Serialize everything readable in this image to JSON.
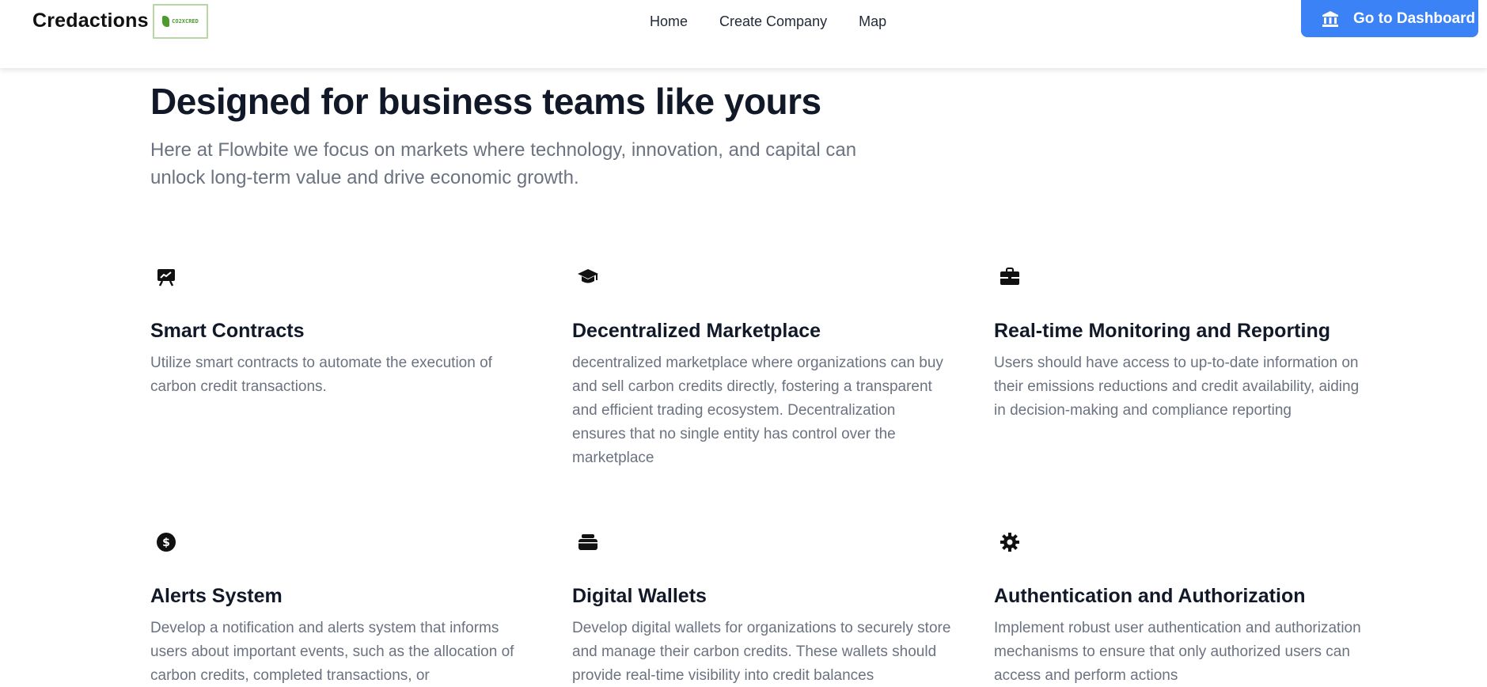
{
  "header": {
    "brand": "Credactions",
    "logo_text": "CO2XCRED",
    "nav": [
      {
        "label": "Home"
      },
      {
        "label": "Create Company"
      },
      {
        "label": "Map"
      }
    ],
    "dashboard_button": "Go to Dashboard"
  },
  "hero": {
    "title": "Designed for business teams like yours",
    "subtitle": "Here at Flowbite we focus on markets where technology, innovation, and capital can unlock long-term value and drive economic growth."
  },
  "features": [
    {
      "icon": "presentation-chart-icon",
      "title": "Smart Contracts",
      "description": "Utilize smart contracts to automate the execution of carbon credit transactions."
    },
    {
      "icon": "graduation-cap-icon",
      "title": "Decentralized Marketplace",
      "description": "decentralized marketplace where organizations can buy and sell carbon credits directly, fostering a transparent and efficient trading ecosystem. Decentralization ensures that no single entity has control over the marketplace"
    },
    {
      "icon": "briefcase-icon",
      "title": "Real-time Monitoring and Reporting",
      "description": "Users should have access to up-to-date information on their emissions reductions and credit availability, aiding in decision-making and compliance reporting"
    },
    {
      "icon": "dollar-circle-icon",
      "title": "Alerts System",
      "description": "Develop a notification and alerts system that informs users about important events, such as the allocation of carbon credits, completed transactions, or"
    },
    {
      "icon": "wallet-icon",
      "title": "Digital Wallets",
      "description": "Develop digital wallets for organizations to securely store and manage their carbon credits. These wallets should provide real-time visibility into credit balances"
    },
    {
      "icon": "gear-icon",
      "title": "Authentication and Authorization",
      "description": "Implement robust user authentication and authorization mechanisms to ensure that only authorized users can access and perform actions"
    }
  ],
  "colors": {
    "accent": "#3b82f6",
    "heading": "#111827",
    "body_text": "#6b7280"
  }
}
